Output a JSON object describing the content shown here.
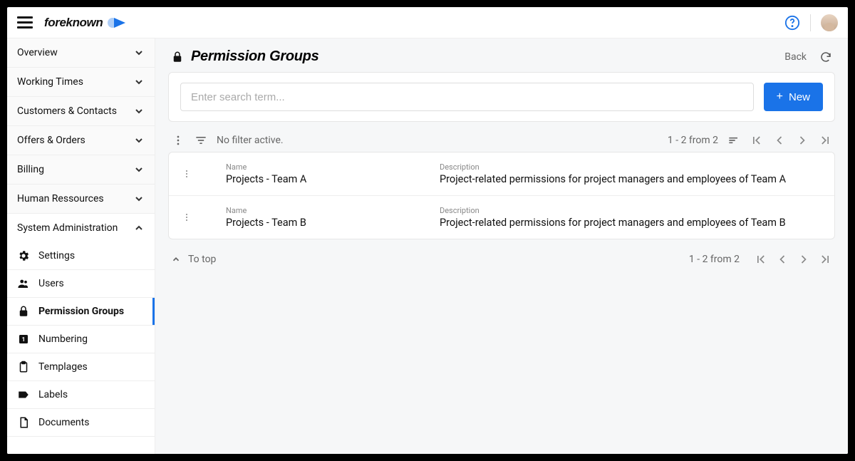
{
  "brand": "foreknown",
  "sidebar": {
    "groups": [
      {
        "label": "Overview",
        "expanded": false
      },
      {
        "label": "Working Times",
        "expanded": false
      },
      {
        "label": "Customers & Contacts",
        "expanded": false
      },
      {
        "label": "Offers & Orders",
        "expanded": false
      },
      {
        "label": "Billing",
        "expanded": false
      },
      {
        "label": "Human Ressources",
        "expanded": false
      },
      {
        "label": "System Administration",
        "expanded": true
      }
    ],
    "items": [
      {
        "label": "Settings"
      },
      {
        "label": "Users"
      },
      {
        "label": "Permission Groups"
      },
      {
        "label": "Numbering"
      },
      {
        "label": "Templages"
      },
      {
        "label": "Labels"
      },
      {
        "label": "Documents"
      }
    ]
  },
  "page": {
    "title": "Permission Groups",
    "back": "Back"
  },
  "search": {
    "placeholder": "Enter search term...",
    "new_label": "New"
  },
  "filter": {
    "status": "No filter active.",
    "pagination": "1 - 2 from 2"
  },
  "table": {
    "name_label": "Name",
    "desc_label": "Description",
    "rows": [
      {
        "name": "Projects - Team A",
        "desc": "Project-related permissions for project managers and employees of Team A"
      },
      {
        "name": "Projects - Team B",
        "desc": "Project-related permissions for project managers and employees of Team B"
      }
    ]
  },
  "footer": {
    "to_top": "To top",
    "pagination": "1 - 2 from 2"
  }
}
